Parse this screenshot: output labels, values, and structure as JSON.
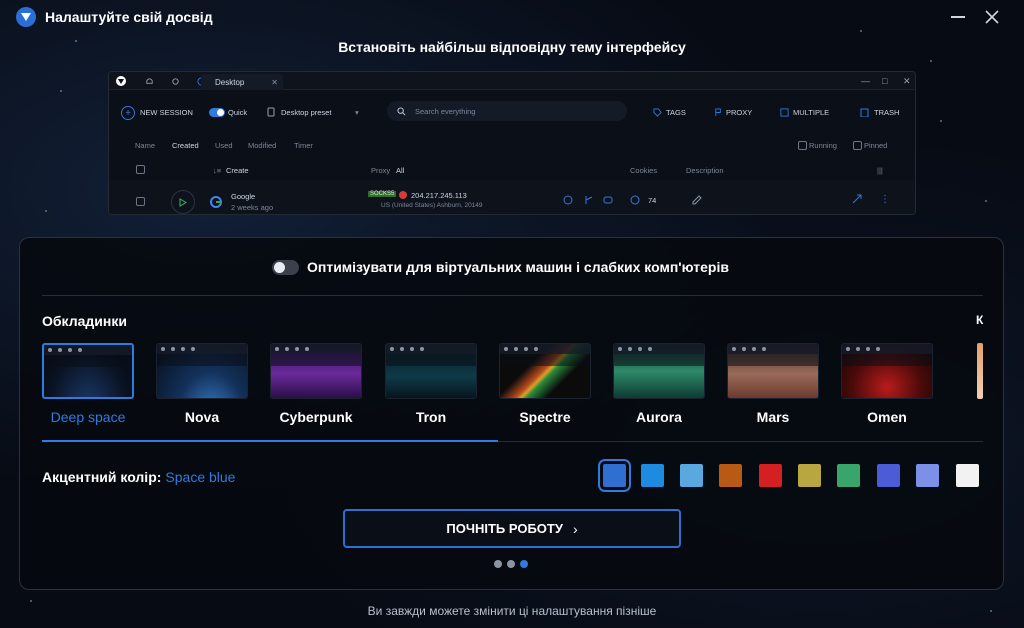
{
  "window": {
    "title": "Налаштуйте свій досвід",
    "logo_icon": "app-logo-icon",
    "minimize_icon": "minimize-icon",
    "close_icon": "close-icon"
  },
  "heading": "Встановіть найбільш відповідну тему інтерфейсу",
  "preview": {
    "tab_label": "Desktop",
    "new_session": "NEW SESSION",
    "quick": "Quick",
    "preset": "Desktop preset",
    "search_placeholder": "Search everything",
    "tags": "TAGS",
    "proxy": "PROXY",
    "multiple": "MULTIPLE",
    "trash": "TRASH",
    "filters": [
      "Name",
      "Created",
      "Used",
      "Modified",
      "Timer"
    ],
    "running": "Running",
    "pinned": "Pinned",
    "col_create": "Create",
    "col_proxy": "Proxy",
    "col_proxy_value": "All",
    "col_cookies": "Cookies",
    "col_description": "Description",
    "row_name": "Google",
    "row_time": "2 weeks ago",
    "row_proxy_type": "SOCKS5",
    "row_ip": "204.217.245.113",
    "row_location": "US (United States) Ashburn, 20149",
    "row_cookies": "74"
  },
  "optimize_label": "Оптимізувати для віртуальних машин і слабких комп'ютерів",
  "covers": {
    "title": "Обкладинки",
    "partial_label": "К",
    "items": [
      {
        "name": "Deep space",
        "selected": true
      },
      {
        "name": "Nova",
        "selected": false
      },
      {
        "name": "Cyberpunk",
        "selected": false
      },
      {
        "name": "Tron",
        "selected": false
      },
      {
        "name": "Spectre",
        "selected": false
      },
      {
        "name": "Aurora",
        "selected": false
      },
      {
        "name": "Mars",
        "selected": false
      },
      {
        "name": "Omen",
        "selected": false
      }
    ]
  },
  "accent": {
    "label": "Акцентний колір:",
    "value": "Space blue",
    "colors": [
      "#2f6fd0",
      "#1e8be0",
      "#5aa8e0",
      "#b85a14",
      "#d42020",
      "#b8a640",
      "#3aa56a",
      "#4a5cd6",
      "#7b90e6",
      "#f2f2f2"
    ],
    "selected_index": 0
  },
  "start_button": "ПОЧНІТЬ РОБОТУ",
  "pager": {
    "count": 3,
    "active": 2
  },
  "footnote": "Ви завжди можете змінити ці налаштування пізніше"
}
